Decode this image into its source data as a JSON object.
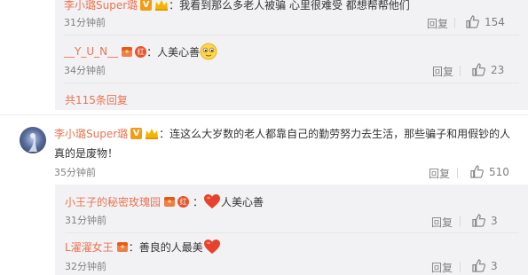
{
  "thread1": {
    "reply1": {
      "user": "李小璐Super璐",
      "text": "：我看到那么多老人被骗 心里很难受 都想帮帮他们",
      "time": "31分钟前",
      "reply_label": "回复",
      "likes": "154"
    },
    "reply2": {
      "user": "__Y_U_N__",
      "text": "：人美心善",
      "time": "34分钟前",
      "reply_label": "回复",
      "likes": "23"
    },
    "more_replies": "共115条回复"
  },
  "comment2": {
    "user": "李小璐Super璐",
    "text_line1": "：连这么大岁数的老人都靠自己的勤劳努力去生活，那些骗子和用假钞的人",
    "text_line2": "真的是废物！",
    "time": "35分钟前",
    "reply_label": "回复",
    "likes": "510",
    "replies": [
      {
        "user": "小王子的秘密玫瑰园",
        "text": "人美心善",
        "time": "31分钟前",
        "reply_label": "回复",
        "likes": "3"
      },
      {
        "user": "L濯濯女王",
        "text": "：善良的人最美",
        "time": "32分钟前",
        "reply_label": "回复",
        "likes": "3"
      }
    ]
  },
  "badges": {
    "v_badge": "V",
    "fans_badge": "红"
  },
  "colors": {
    "username": "#eb7350",
    "muted": "#808080",
    "sub_background": "#f2f2f5",
    "heart": "#e8412c"
  },
  "icons": [
    "vip-v-icon",
    "crown-icon",
    "hongbao-icon",
    "fans-badge-icon",
    "heart-emoji-icon",
    "smile-emoji-icon",
    "thumbs-up-icon"
  ]
}
